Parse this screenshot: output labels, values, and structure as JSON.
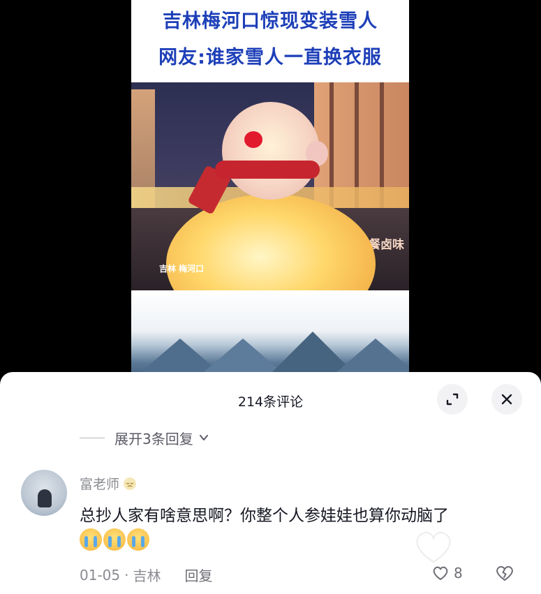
{
  "video": {
    "caption_line1": "吉林梅河口惊现变装雪人",
    "caption_line2": "网友:谁家雪人一直换衣服",
    "place_tag": "吉林 梅河口",
    "shop_sign": "餐卤味"
  },
  "comments_panel": {
    "title": "214条评论",
    "expand_replies": "展开3条回复",
    "icons": {
      "expand": "expand-icon",
      "close": "close-icon",
      "chevron": "chevron-down-icon",
      "like": "heart-icon",
      "dislike": "broken-heart-icon"
    },
    "comment": {
      "username": "富老师",
      "text": "总抄人家有啥意思啊？你整个人参娃娃也算你动脑了",
      "emoji_count": 3,
      "date": "01-05",
      "location": "吉林",
      "reply_label": "回复",
      "likes": "8"
    }
  },
  "colors": {
    "caption_blue": "#1d3fb8",
    "text_primary": "#161823",
    "text_secondary": "#8a8b91",
    "scarf_red": "#c6242e"
  }
}
